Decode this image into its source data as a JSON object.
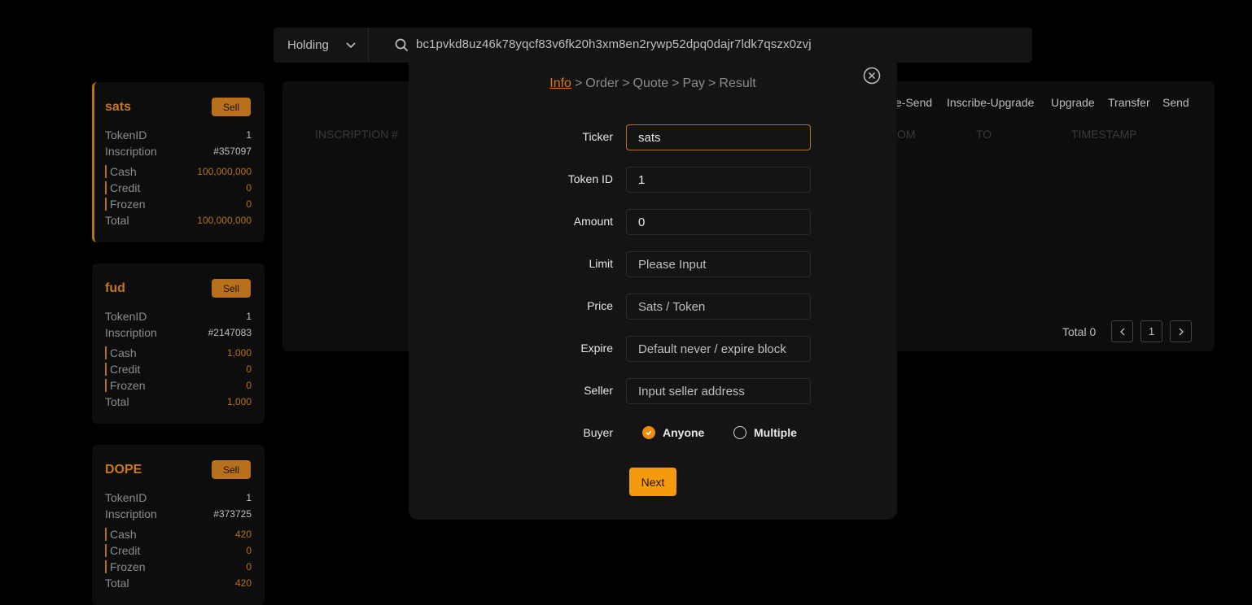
{
  "topbar": {
    "filter": "Holding",
    "address": "bc1pvkd8uz46k78yqcf83v6fk20h3xm8en2rywp52dpq0dajr7ldk7qszx0zvj"
  },
  "cards": [
    {
      "name": "sats",
      "sell": "Sell",
      "token_id_label": "TokenID",
      "token_id": "1",
      "inscription_label": "Inscription",
      "inscription": "#357097",
      "cash_label": "Cash",
      "cash": "100,000,000",
      "credit_label": "Credit",
      "credit": "0",
      "frozen_label": "Frozen",
      "frozen": "0",
      "total_label": "Total",
      "total": "100,000,000"
    },
    {
      "name": "fud",
      "sell": "Sell",
      "token_id_label": "TokenID",
      "token_id": "1",
      "inscription_label": "Inscription",
      "inscription": "#2147083",
      "cash_label": "Cash",
      "cash": "1,000",
      "credit_label": "Credit",
      "credit": "0",
      "frozen_label": "Frozen",
      "frozen": "0",
      "total_label": "Total",
      "total": "1,000"
    },
    {
      "name": "DOPE",
      "sell": "Sell",
      "token_id_label": "TokenID",
      "token_id": "1",
      "inscription_label": "Inscription",
      "inscription": "#373725",
      "cash_label": "Cash",
      "cash": "420",
      "credit_label": "Credit",
      "credit": "0",
      "frozen_label": "Frozen",
      "frozen": "0",
      "total_label": "Total",
      "total": "420"
    }
  ],
  "panel": {
    "tabs": [
      "e-Send",
      "Inscribe-Upgrade",
      "Upgrade",
      "Transfer",
      "Send"
    ],
    "columns": [
      "INSCRIPTION #",
      "OM",
      "TO",
      "TIMESTAMP"
    ],
    "total": "Total 0",
    "page": "1"
  },
  "modal": {
    "steps": [
      "Info",
      "Order",
      "Quote",
      "Pay",
      "Result"
    ],
    "separator": ">",
    "fields": {
      "ticker": {
        "label": "Ticker",
        "value": "sats"
      },
      "token_id": {
        "label": "Token ID",
        "value": "1"
      },
      "amount": {
        "label": "Amount",
        "value": "0"
      },
      "limit": {
        "label": "Limit",
        "placeholder": "Please Input"
      },
      "price": {
        "label": "Price",
        "placeholder": "Sats / Token"
      },
      "expire": {
        "label": "Expire",
        "placeholder": "Default never / expire block"
      },
      "seller": {
        "label": "Seller",
        "placeholder": "Input seller address"
      }
    },
    "buyer": {
      "label": "Buyer",
      "option_anyone": "Anyone",
      "option_multiple": "Multiple",
      "selected": "Anyone"
    },
    "next": "Next"
  },
  "colors": {
    "accent": "#f59a0c",
    "accent_dark": "#b8701a",
    "background": "#000000",
    "modal": "#141414"
  }
}
